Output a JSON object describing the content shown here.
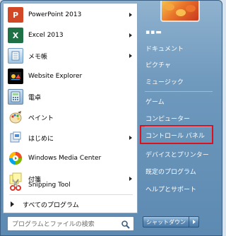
{
  "start_menu": {
    "programs": [
      {
        "label": "PowerPoint 2013",
        "icon": "powerpoint-icon",
        "has_submenu": true
      },
      {
        "label": "Excel 2013",
        "icon": "excel-icon",
        "has_submenu": true
      },
      {
        "label": "メモ帳",
        "icon": "notepad-icon",
        "has_submenu": true
      },
      {
        "label": "Website Explorer",
        "icon": "website-explorer-icon",
        "has_submenu": false
      },
      {
        "label": "電卓",
        "icon": "calculator-icon",
        "has_submenu": false
      },
      {
        "label": "ペイント",
        "icon": "paint-icon",
        "has_submenu": false
      },
      {
        "label": "はじめに",
        "icon": "getting-started-icon",
        "has_submenu": true
      },
      {
        "label": "Windows Media Center",
        "icon": "media-center-icon",
        "has_submenu": false
      },
      {
        "label": "付箋",
        "icon": "sticky-notes-icon",
        "has_submenu": true
      },
      {
        "label": "Snipping Tool",
        "icon": "snipping-tool-icon",
        "has_submenu": false
      }
    ],
    "all_programs_label": "すべてのプログラム",
    "search_placeholder": "プログラムとファイルの検索",
    "user_name": "▪▪▬",
    "right_items": [
      {
        "label": "ドキュメント"
      },
      {
        "label": "ピクチャ"
      },
      {
        "label": "ミュージック"
      },
      {
        "label": "ゲーム"
      },
      {
        "label": "コンピューター"
      },
      {
        "label": "コントロール パネル",
        "highlighted": true
      },
      {
        "label": "デバイスとプリンター"
      },
      {
        "label": "既定のプログラム"
      },
      {
        "label": "ヘルプとサポート"
      }
    ],
    "shutdown_label": "シャットダウン",
    "colors": {
      "highlight_border": "#e0101a",
      "right_pane_text": "#ffffff"
    }
  }
}
